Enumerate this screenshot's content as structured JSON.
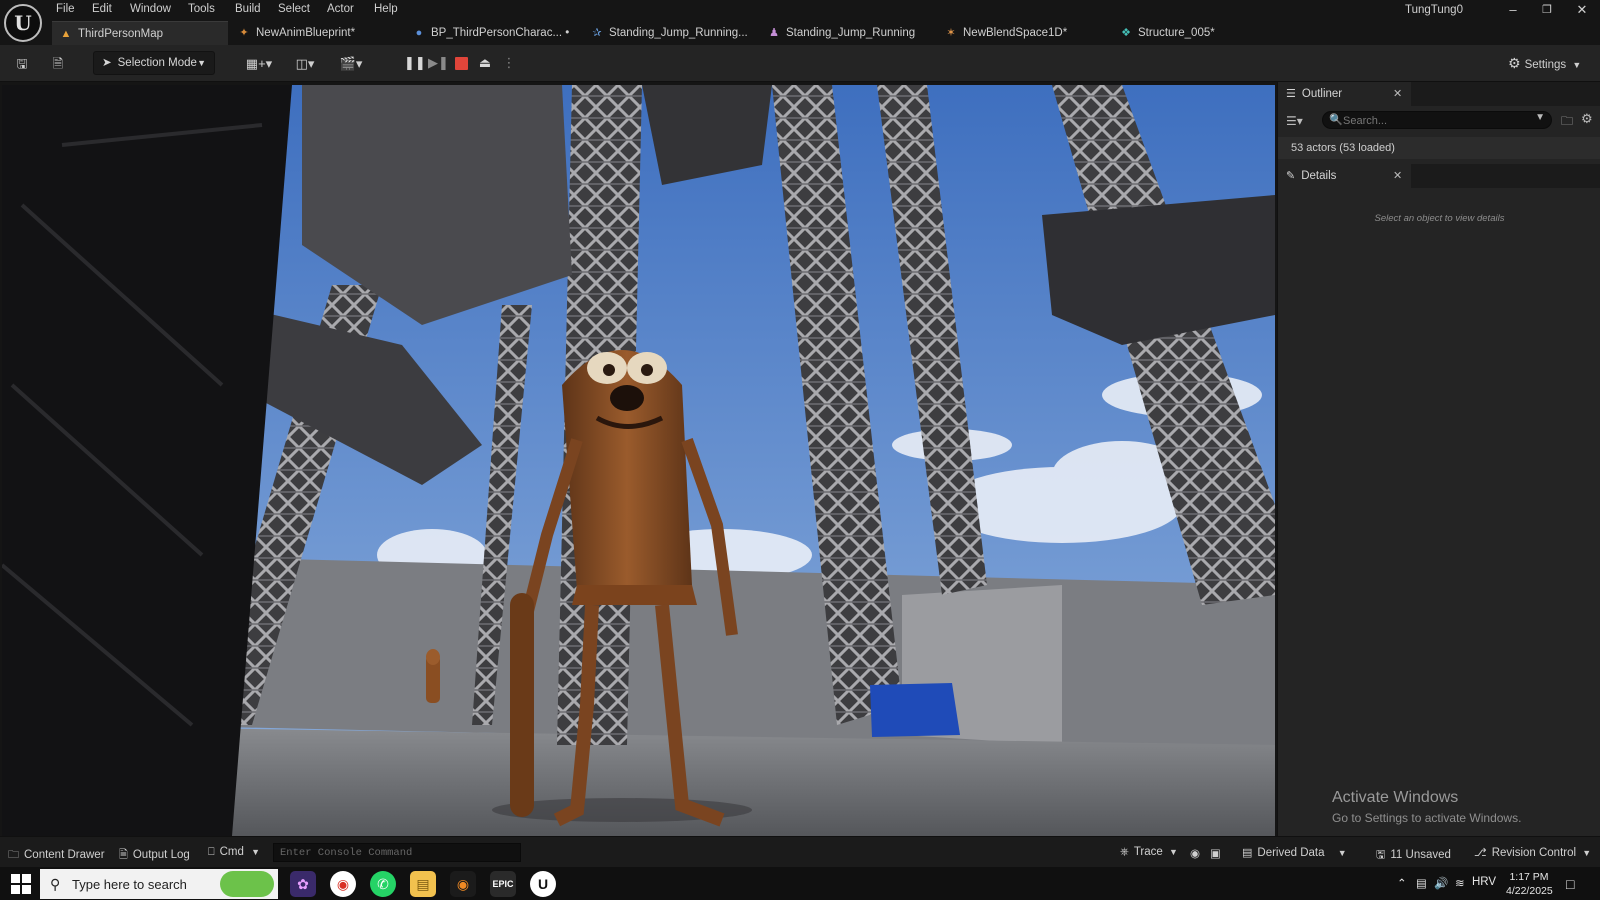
{
  "app": {
    "user": "TungTung0"
  },
  "menu": [
    "File",
    "Edit",
    "Window",
    "Tools",
    "Build",
    "Select",
    "Actor",
    "Help"
  ],
  "tabs": [
    {
      "label": "ThirdPersonMap",
      "icon": "level-icon"
    },
    {
      "label": "NewAnimBlueprint*",
      "icon": "anim-blueprint-icon"
    },
    {
      "label": "BP_ThirdPersonCharac... •",
      "icon": "blueprint-icon"
    },
    {
      "label": "Standing_Jump_Running...",
      "icon": "anim-sequence-icon"
    },
    {
      "label": "Standing_Jump_Running",
      "icon": "skeleton-icon"
    },
    {
      "label": "NewBlendSpace1D*",
      "icon": "blendspace-icon"
    },
    {
      "label": "Structure_005*",
      "icon": "structure-icon"
    }
  ],
  "toolbar": {
    "selection_mode": "Selection Mode",
    "settings": "Settings"
  },
  "outliner": {
    "title": "Outliner",
    "search_placeholder": "Search...",
    "actor_count": "53 actors (53 loaded)"
  },
  "details": {
    "title": "Details",
    "hint": "Select an object to view details"
  },
  "statusbar": {
    "content_drawer": "Content Drawer",
    "output_log": "Output Log",
    "cmd": "Cmd",
    "console_placeholder": "Enter Console Command",
    "trace": "Trace",
    "derived_data": "Derived Data",
    "unsaved": "11 Unsaved",
    "revision_control": "Revision Control"
  },
  "watermark": {
    "title": "Activate Windows",
    "subtitle": "Go to Settings to activate Windows."
  },
  "taskbar": {
    "search_placeholder": "Type here to search",
    "language": "HRV",
    "time": "1:17 PM",
    "date": "4/22/2025"
  },
  "colors": {
    "accent_stop": "#e0453a",
    "sky": "#4f7fc6",
    "panel_bg": "#242424",
    "titlebar_bg": "#151515"
  }
}
